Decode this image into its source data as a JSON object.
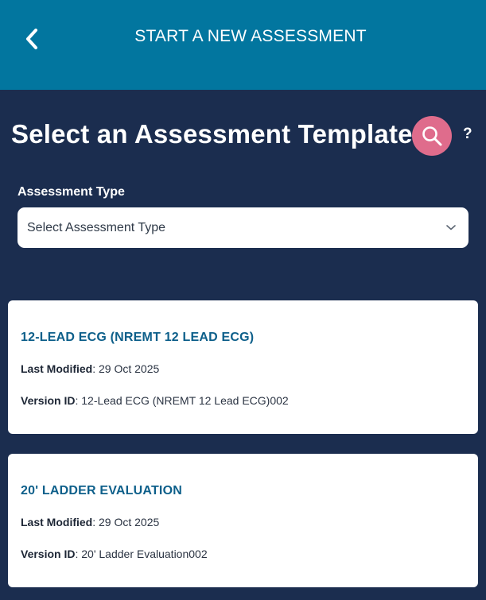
{
  "header": {
    "title": "START A NEW ASSESSMENT",
    "back_icon": "chevron-left-icon"
  },
  "main": {
    "title": "Select an Assessment Template",
    "search_icon": "search-icon",
    "help_label": "?",
    "assessment_type": {
      "label": "Assessment Type",
      "placeholder": "Select Assessment Type",
      "chevron_icon": "chevron-down-icon"
    },
    "templates": [
      {
        "name": "12-LEAD ECG (NREMT 12 LEAD ECG)",
        "last_modified_label": "Last Modified",
        "last_modified": "29 Oct 2025",
        "version_label": "Version ID",
        "version_id": "12-Lead ECG (NREMT 12 Lead ECG)002"
      },
      {
        "name": "20' LADDER EVALUATION",
        "last_modified_label": "Last Modified",
        "last_modified": "29 Oct 2025",
        "version_label": "Version ID",
        "version_id": "20' Ladder Evaluation002"
      }
    ]
  },
  "colors": {
    "header_bg": "#02769f",
    "page_bg": "#1b2d4f",
    "search_button": "#df6c8c",
    "card_title": "#0d5f8a"
  }
}
